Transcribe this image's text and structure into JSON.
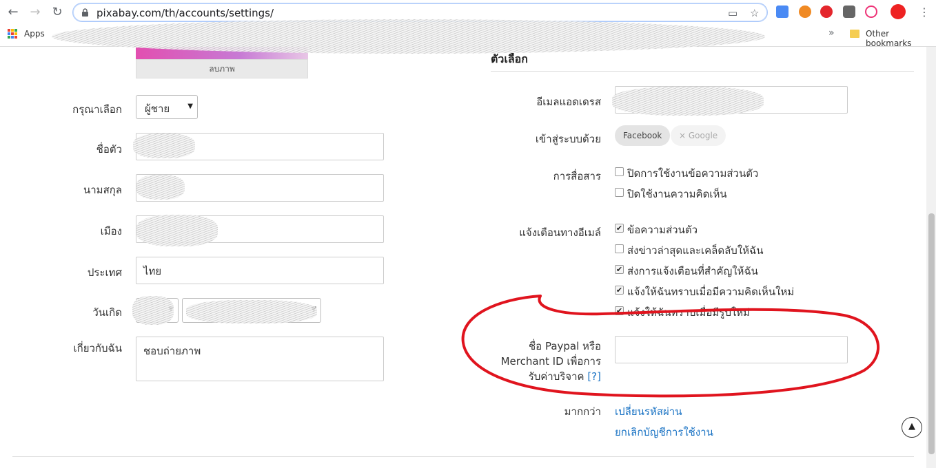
{
  "browser": {
    "url": "pixabay.com/th/accounts/settings/",
    "apps_label": "Apps",
    "bookmarks_overflow": "»",
    "other_bookmarks": "Other bookmarks"
  },
  "photo": {
    "delete_label": "ลบภาพ"
  },
  "profile": {
    "gender_label": "กรุณาเลือก",
    "gender_value": "ผู้ชาย",
    "first_name_label": "ชื่อตัว",
    "last_name_label": "นามสกุล",
    "city_label": "เมือง",
    "country_label": "ประเทศ",
    "country_value": "ไทย",
    "birthday_label": "วันเกิด",
    "about_label": "เกี่ยวกับฉัน",
    "about_value": "ชอบถ่ายภาพ"
  },
  "options": {
    "title": "ตัวเลือก",
    "email_label": "อีเมลแอดเดรส",
    "login_label": "เข้าสู่ระบบด้วย",
    "login_facebook": "Facebook",
    "login_google": "× Google",
    "communication_label": "การสื่อสาร",
    "communication": [
      {
        "text": "ปิดการใช้งานข้อความส่วนตัว",
        "checked": false
      },
      {
        "text": "ปิดใช้งานความคิดเห็น",
        "checked": false
      }
    ],
    "email_notify_label": "แจ้งเตือนทางอีเมล์",
    "email_notify": [
      {
        "text": "ข้อความส่วนตัว",
        "checked": true
      },
      {
        "text": "ส่งข่าวล่าสุดและเคล็ดลับให้ฉัน",
        "checked": false
      },
      {
        "text": "ส่งการแจ้งเตือนที่สำคัญให้ฉัน",
        "checked": true
      },
      {
        "text": "แจ้งให้ฉันทราบเมื่อมีความคิดเห็นใหม่",
        "checked": true
      },
      {
        "text": "แจ้งให้ฉันทราบเมื่อมีรูปใหม่",
        "checked": true
      }
    ],
    "paypal_label_1": "ชื่อ Paypal หรือ",
    "paypal_label_2": "Merchant ID เพื่อการ",
    "paypal_label_3": "รับค่าบริจาค",
    "paypal_help": "[?]",
    "more_label": "มากกว่า",
    "change_password": "เปลี่ยนรหัสผ่าน",
    "cancel_account": "ยกเลิกบัญชีการใช้งาน"
  },
  "colors": {
    "accent_link": "#1a73c4",
    "annotation": "#e0141e"
  },
  "icons": {
    "back": "arrow-left-icon",
    "forward": "arrow-right-icon",
    "reload": "reload-icon",
    "scroll_top": "arrow-up-icon"
  }
}
